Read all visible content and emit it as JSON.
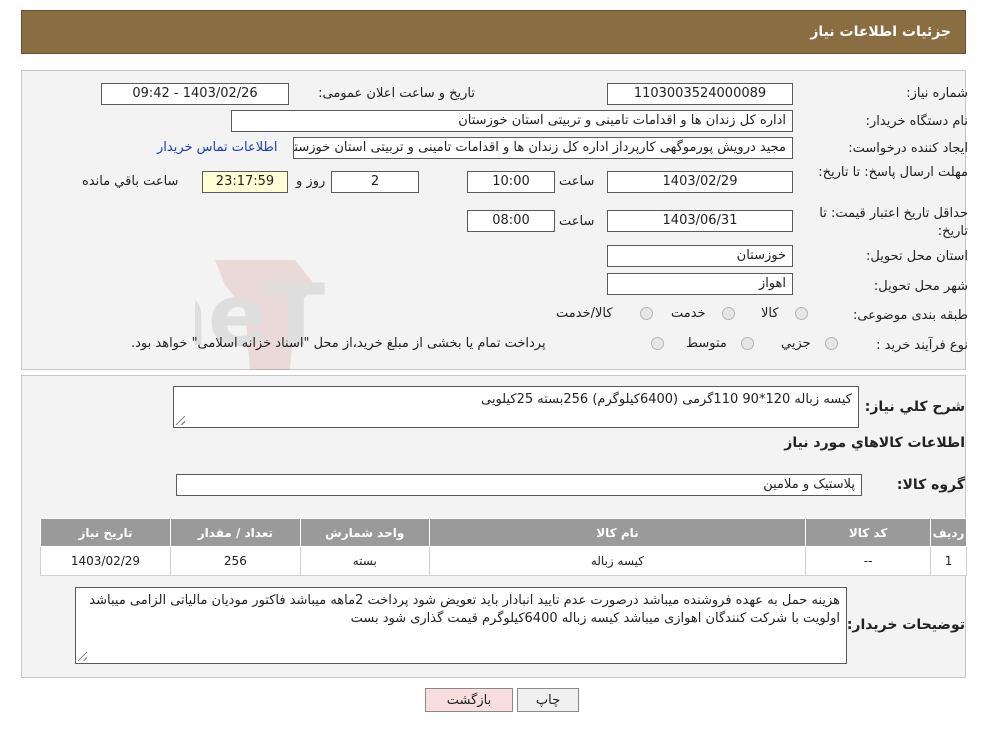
{
  "header": {
    "title": "جزئیات اطلاعات نیاز"
  },
  "fields": {
    "need_number_label": "شماره نیاز:",
    "need_number": "1103003524000089",
    "announce_label": "تاریخ و ساعت اعلان عمومی:",
    "announce_value": "1403/02/26 - 09:42",
    "buyer_org_label": "نام دستگاه خریدار:",
    "buyer_org": "اداره کل زندان ها و اقدامات تامینی و تربیتی استان خوزستان",
    "requester_label": "ایجاد کننده درخواست:",
    "requester": "مجید درویش پورموگهی کارپرداز اداره کل زندان ها و اقدامات تامینی و تربیتی استان خوزستان",
    "contact_link": "اطلاعات تماس خریدار",
    "deadline_label": "مهلت ارسال پاسخ: تا تاریخ:",
    "deadline_date": "1403/02/29",
    "time_label": "ساعت",
    "deadline_time": "10:00",
    "days_value": "2",
    "days_label": "روز و",
    "remaining_time": "23:17:59",
    "remaining_label": "ساعت باقي مانده",
    "validity_label": "حداقل تاریخ اعتبار قیمت: تا تاریخ:",
    "validity_date": "1403/06/31",
    "validity_time": "08:00",
    "province_label": "استان محل تحویل:",
    "province": "خوزستان",
    "city_label": "شهر محل تحویل:",
    "city": "اهواز",
    "category_label": "طبقه بندی موضوعی:",
    "category_options": [
      "کالا",
      "خدمت",
      "کالا/خدمت"
    ],
    "process_label": "نوع فرآیند خرید :",
    "process_options": [
      "جزیي",
      "متوسط"
    ],
    "process_note": "پرداخت تمام یا بخشی از مبلغ خرید،از محل \"اسناد خزانه اسلامی\" خواهد بود."
  },
  "summary": {
    "label": "شرح کلي نیاز:",
    "text": "کیسه زباله 120*90    110گرمی (6400کیلوگرم)  256بسته 25کیلویی"
  },
  "goods": {
    "section_title": "اطلاعات کالاهاي مورد نیاز",
    "group_label": "گروه کالا:",
    "group_value": "پلاستیک و ملامین"
  },
  "table": {
    "headers": [
      "ردیف",
      "کد کالا",
      "نام کالا",
      "واحد شمارش",
      "تعداد / مقدار",
      "تاریخ نیاز"
    ],
    "rows": [
      [
        "1",
        "--",
        "کیسه زباله",
        "بسته",
        "256",
        "1403/02/29"
      ]
    ]
  },
  "buyer_notes": {
    "label": "توضیحات خریدار:",
    "text": "هزینه حمل به عهده فروشنده میباشد درصورت عدم تایید انبادار باید تعویض شود پرداخت 2ماهه میباشد فاکتور مودیان مالیاتی الزامی میباشد اولویت با شرکت کنندگان اهوازی میباشد کیسه زباله 6400کیلوگرم قیمت گذاری شود بست"
  },
  "buttons": {
    "print": "چاپ",
    "back": "بازگشت"
  },
  "watermark": {
    "text": "AriaTender.neT"
  },
  "colors": {
    "header_bg": "#8b6d42",
    "link": "#1a3dbf",
    "back_btn_bg": "#f8dede",
    "table_head_bg": "#9a9a9a"
  }
}
